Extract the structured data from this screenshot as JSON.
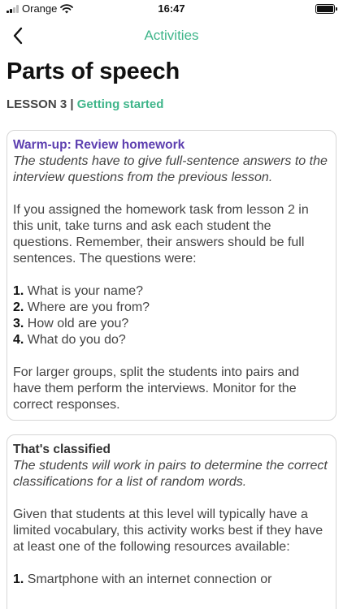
{
  "status": {
    "carrier": "Orange",
    "time": "16:47"
  },
  "nav": {
    "title": "Activities",
    "back_icon": "chevron-left-icon"
  },
  "header": {
    "title": "Parts of speech",
    "lesson_label": "LESSON 3",
    "separator": "|",
    "lesson_name": "Getting started"
  },
  "cards": [
    {
      "title": "Warm-up: Review homework",
      "subtitle": "The students have to give full-sentence answers to the interview questions from the previous lesson.",
      "paragraph1": "If you assigned the homework task from lesson 2 in this unit, take turns and ask each student the questions. Remember, their answers should be full sentences. The questions were:",
      "list": [
        {
          "num": "1.",
          "text": "What is your name?"
        },
        {
          "num": "2.",
          "text": "Where are you from?"
        },
        {
          "num": "3.",
          "text": "How old are you?"
        },
        {
          "num": "4.",
          "text": "What do you do?"
        }
      ],
      "paragraph2": "For larger groups, split the students into pairs and have them perform the interviews. Monitor for the correct responses."
    },
    {
      "title": "That's classified",
      "subtitle": "The students will work in pairs to determine the correct classifications for a list of random words.",
      "paragraph1": "Given that students at this level will typically have a limited vocabulary, this activity works best if they have at least one of the following resources available:",
      "list": [
        {
          "num": "1.",
          "text": "Smartphone with an internet connection or"
        }
      ]
    }
  ],
  "colors": {
    "accent_green": "#3fb58a",
    "card_title_purple": "#5d3fb0"
  }
}
